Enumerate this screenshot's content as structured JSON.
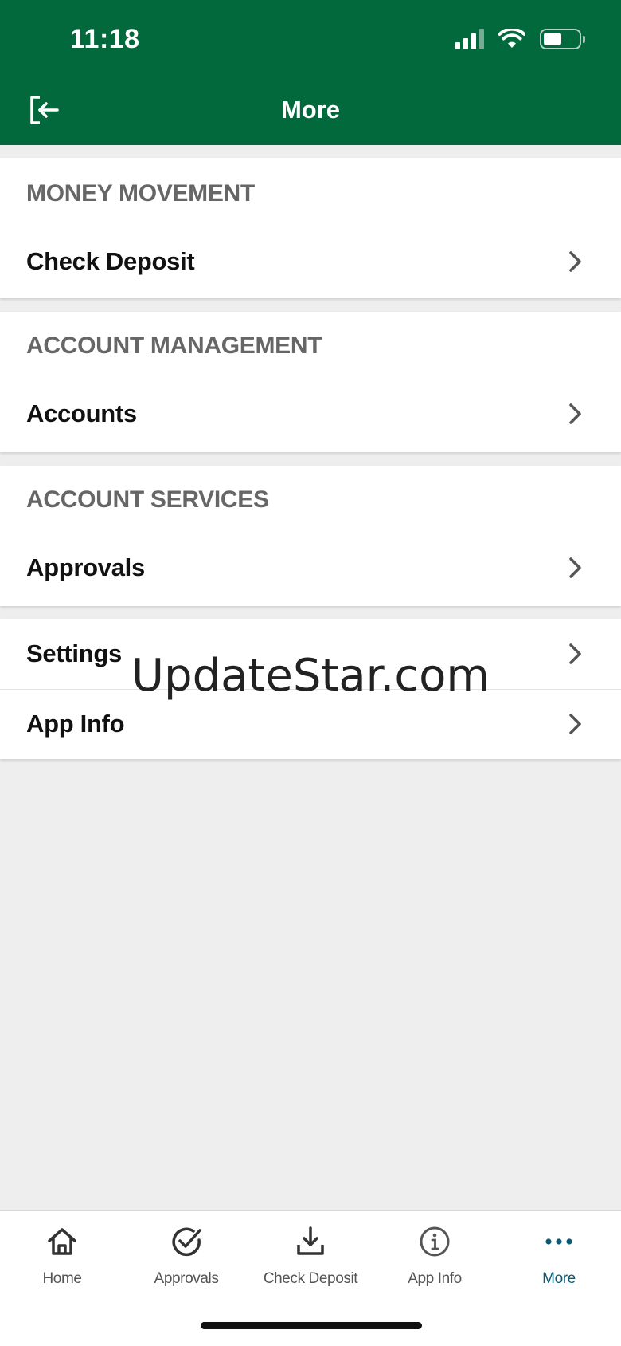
{
  "status_bar": {
    "time": "11:18"
  },
  "header": {
    "title": "More"
  },
  "sections": [
    {
      "title": "MONEY MOVEMENT",
      "items": [
        {
          "label": "Check Deposit"
        }
      ]
    },
    {
      "title": "ACCOUNT MANAGEMENT",
      "items": [
        {
          "label": "Accounts"
        }
      ]
    },
    {
      "title": "ACCOUNT SERVICES",
      "items": [
        {
          "label": "Approvals"
        }
      ]
    },
    {
      "title": "",
      "items": [
        {
          "label": "Settings"
        },
        {
          "label": "App Info"
        }
      ]
    }
  ],
  "watermark": "UpdateStar.com",
  "tabbar": {
    "active": "More",
    "tabs": [
      {
        "label": "Home",
        "icon": "home-icon"
      },
      {
        "label": "Approvals",
        "icon": "check-circle-icon"
      },
      {
        "label": "Check Deposit",
        "icon": "download-tray-icon"
      },
      {
        "label": "App Info",
        "icon": "info-circle-icon"
      },
      {
        "label": "More",
        "icon": "more-dots-icon"
      }
    ]
  },
  "colors": {
    "brand": "#02693d",
    "active_tab": "#0b5a73",
    "background": "#eeeeee"
  }
}
